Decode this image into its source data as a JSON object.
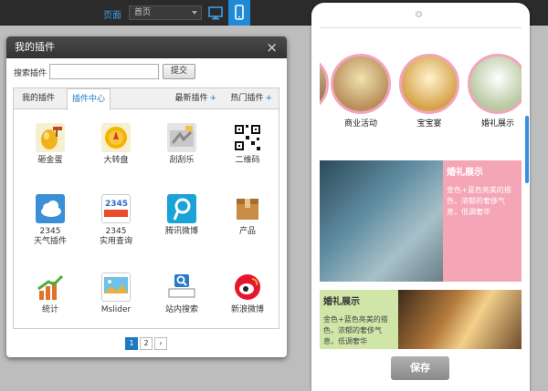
{
  "topbar": {
    "page_label": "页面",
    "page_select_value": "首页",
    "desktop_icon": "desktop-icon",
    "mobile_icon": "mobile-icon",
    "active_color": "#1e8ad8"
  },
  "dialog": {
    "title": "我的插件",
    "close_symbol": "×",
    "search_label": "搜索插件",
    "search_value": "",
    "submit_label": "提交",
    "tabs": {
      "my": "我的插件",
      "center": "插件中心",
      "new": "最新插件",
      "hot": "热门插件",
      "plus": "+"
    },
    "plugins": [
      {
        "name": "砸金蛋",
        "icon": "golden-egg-icon"
      },
      {
        "name": "大转盘",
        "icon": "wheel-icon"
      },
      {
        "name": "刮刮乐",
        "icon": "scratch-card-icon"
      },
      {
        "name": "二维码",
        "icon": "qrcode-icon"
      },
      {
        "name": "2345\n天气插件",
        "icon": "weather-icon"
      },
      {
        "name": "2345\n实用查询",
        "icon": "query-icon"
      },
      {
        "name": "腾讯微博",
        "icon": "tencent-weibo-icon"
      },
      {
        "name": "产品",
        "icon": "product-box-icon"
      },
      {
        "name": "统计",
        "icon": "stats-chart-icon"
      },
      {
        "name": "Mslider",
        "icon": "slider-image-icon"
      },
      {
        "name": "站内搜索",
        "icon": "site-search-icon"
      },
      {
        "name": "新浪微博",
        "icon": "sina-weibo-icon"
      }
    ],
    "pager": {
      "page1": "1",
      "page2": "2",
      "next": "›"
    }
  },
  "phone": {
    "circles": [
      {
        "label": "商业活动"
      },
      {
        "label": "宝宝宴"
      },
      {
        "label": "婚礼展示"
      }
    ],
    "feature1": {
      "title": "婚礼展示",
      "desc": "金色+蓝色亮美的搭色，浓郁的奢侈气息，低调奢华"
    },
    "feature2": {
      "title": "婚礼展示",
      "desc": "金色+蓝色亮美的搭色，浓郁的奢侈气息，低调奢华"
    },
    "save_label": "保存",
    "accent_pink": "#f4a6b6",
    "accent_green": "#cfe6a8"
  }
}
